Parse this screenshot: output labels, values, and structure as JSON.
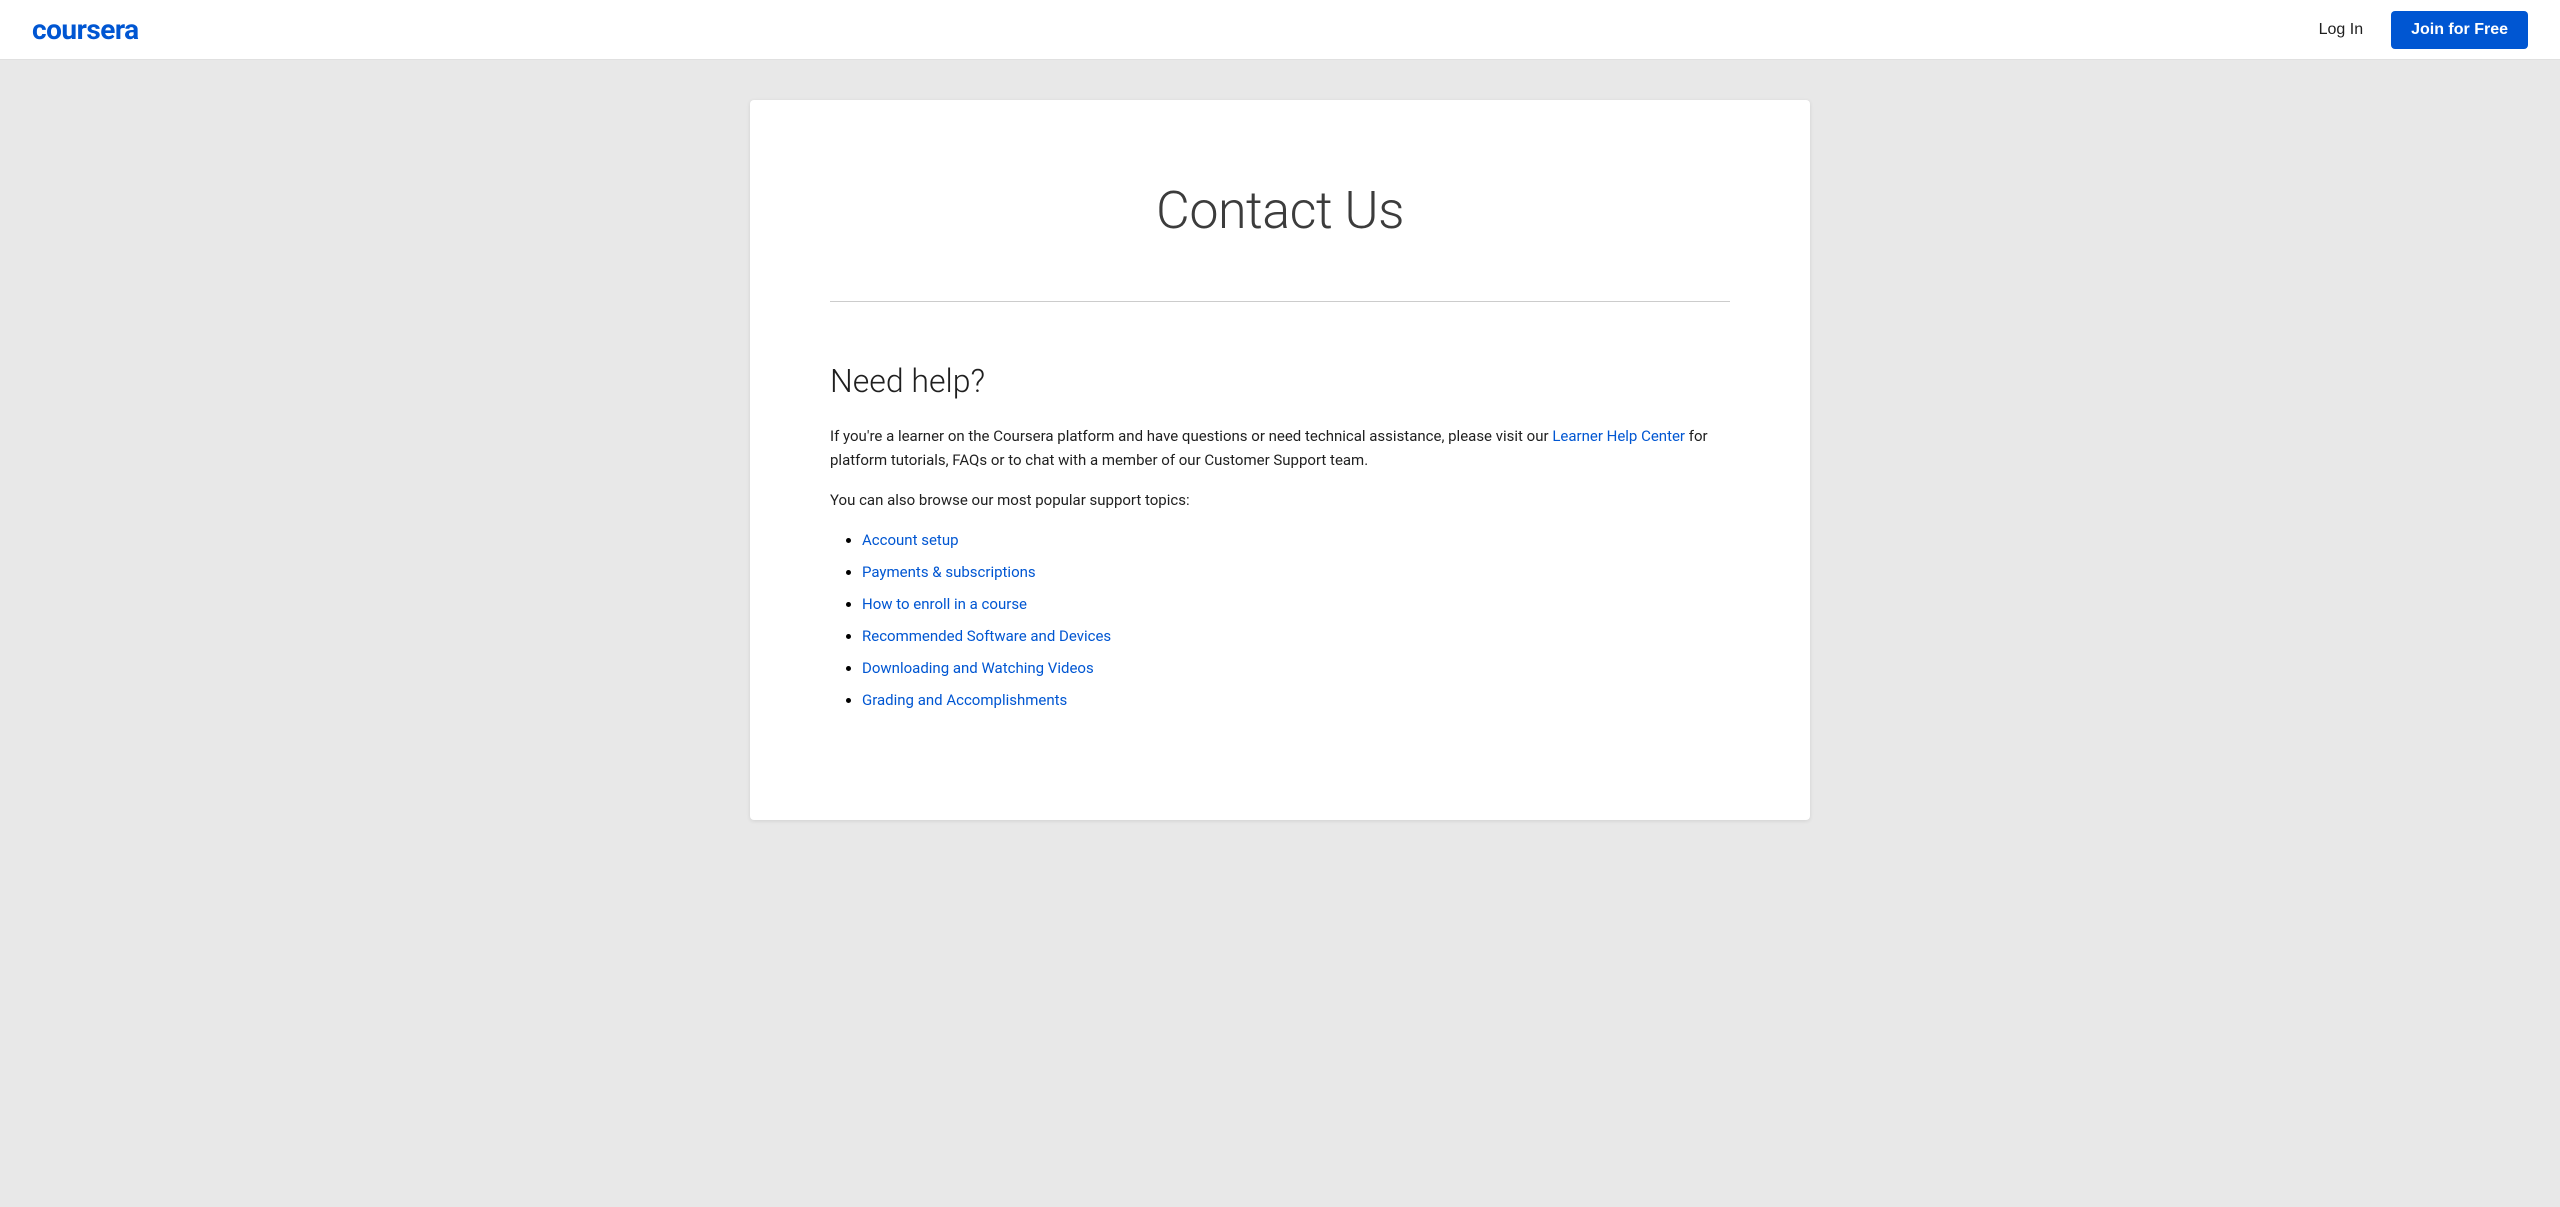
{
  "header": {
    "logo_text": "coursera",
    "login_label": "Log In",
    "join_label": "Join for Free"
  },
  "main": {
    "page_title": "Contact Us",
    "section": {
      "heading": "Need help?",
      "intro_paragraph": "If you're a learner on the Coursera platform and have questions or need technical assistance, please visit our",
      "link_text": "Learner Help Center",
      "intro_paragraph_end": " for platform tutorials, FAQs or to chat with a member of our Customer Support team.",
      "browse_text": "You can also browse our most popular support topics:",
      "topics": [
        {
          "label": "Account setup",
          "href": "#"
        },
        {
          "label": "Payments & subscriptions",
          "href": "#"
        },
        {
          "label": "How to enroll in a course",
          "href": "#"
        },
        {
          "label": "Recommended Software and Devices",
          "href": "#"
        },
        {
          "label": "Downloading and Watching Videos",
          "href": "#"
        },
        {
          "label": "Grading and Accomplishments",
          "href": "#"
        }
      ]
    }
  }
}
